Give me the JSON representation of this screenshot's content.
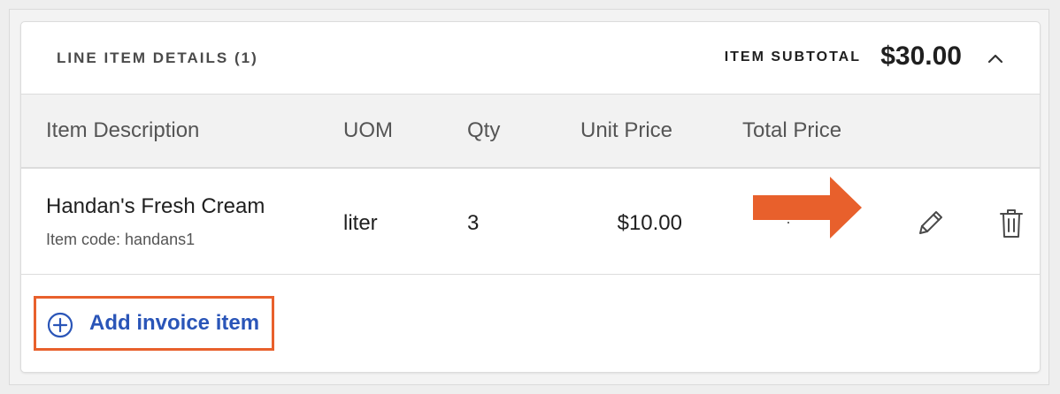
{
  "header": {
    "title": "LINE ITEM DETAILS (1)",
    "subtotal_label": "ITEM SUBTOTAL",
    "subtotal_value": "$30.00",
    "collapse_icon": "chevron-up-icon"
  },
  "columns": [
    "Item Description",
    "UOM",
    "Qty",
    "Unit Price",
    "Total Price"
  ],
  "items": [
    {
      "name": "Handan's Fresh Cream",
      "code": "Item code: handans1",
      "uom": "liter",
      "qty": "3",
      "unit_price": "$10.00",
      "total_price": "",
      "edit_icon": "pencil-icon",
      "delete_icon": "trash-icon"
    }
  ],
  "footer": {
    "add_label": "Add invoice item",
    "add_icon": "plus-circle-icon"
  },
  "annotation": {
    "highlight_color": "#e8602c",
    "arrow_color": "#e8602c"
  },
  "colors": {
    "link": "#2a55b8",
    "header_bg": "#f2f2f2"
  }
}
